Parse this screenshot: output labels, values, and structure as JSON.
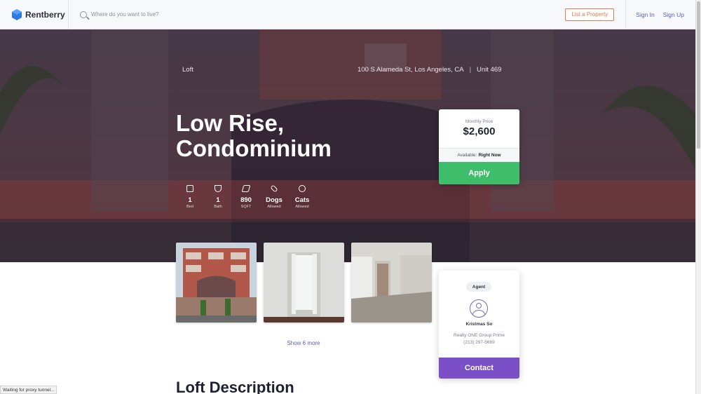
{
  "header": {
    "logo_text": "Rentberry",
    "search_placeholder": "Where do you want to live?",
    "list_property_label": "List a Property",
    "sign_in_label": "Sign In",
    "sign_up_label": "Sign Up"
  },
  "listing": {
    "type": "Loft",
    "address": "100 S Alameda St, Los Angeles, CA",
    "unit": "Unit 469",
    "title_line1": "Low Rise,",
    "title_line2": "Condominium",
    "features": [
      {
        "value": "1",
        "label": "Bed"
      },
      {
        "value": "1",
        "label": "Bath"
      },
      {
        "value": "890",
        "label": "SQFT"
      },
      {
        "value": "Dogs",
        "label": "Allowed"
      },
      {
        "value": "Cats",
        "label": "Allowed"
      }
    ]
  },
  "price_card": {
    "label": "Monthly Price",
    "value": "$2,600",
    "available_label": "Available:",
    "available_value": "Right Now",
    "apply_label": "Apply"
  },
  "gallery": {
    "show_more_label": "Show 6 more"
  },
  "agent": {
    "badge": "Agent",
    "name": "Kristmas So",
    "company": "Realty ONE Group Prime",
    "phone": "(213) 297-5669",
    "contact_label": "Contact"
  },
  "description": {
    "heading": "Loft Description"
  },
  "status_bar": {
    "text": "Waiting for proxy tunnel..."
  },
  "colors": {
    "brand_blue": "#2d7be0",
    "apply_green": "#3ebd6a",
    "contact_purple": "#7b4fc6",
    "link_purple": "#5a5fb0",
    "list_orange": "#e07a4f"
  }
}
